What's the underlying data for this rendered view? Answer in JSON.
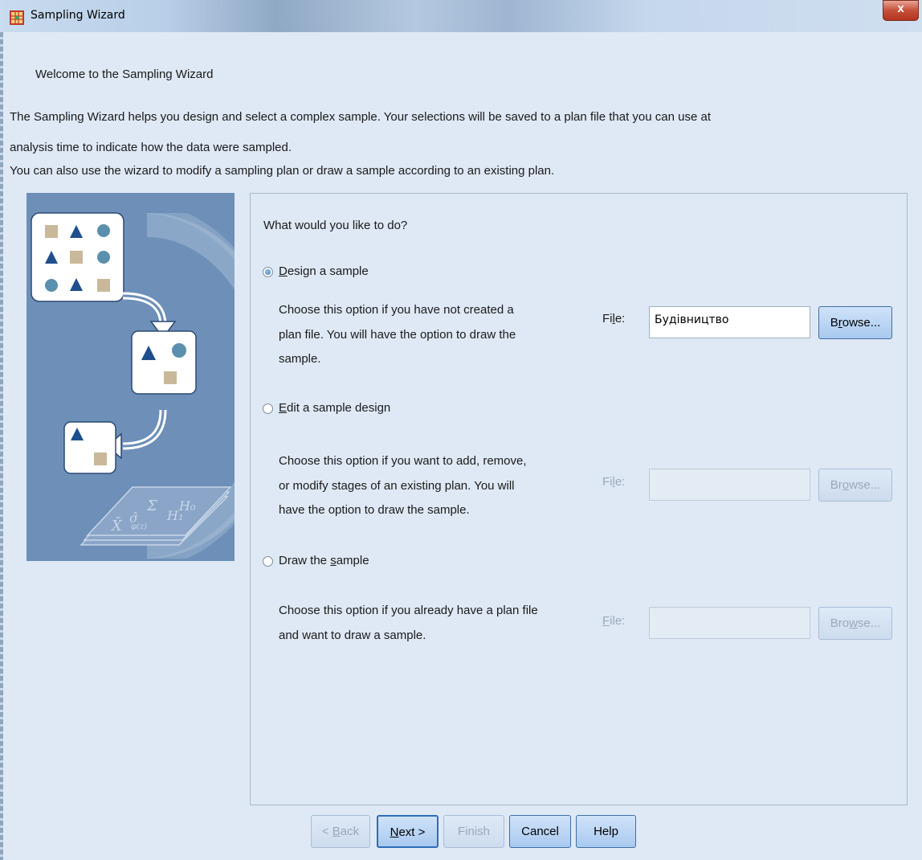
{
  "window": {
    "title": "Sampling Wizard",
    "close_label": "x"
  },
  "heading": "Welcome to the Sampling Wizard",
  "intro": {
    "line1": "The Sampling Wizard helps you design and select a complex sample. Your selections will be saved to a plan file that you can use at",
    "line2": "analysis time to indicate how the data were sampled.",
    "line3": "You can also use the wizard to modify a sampling plan or draw a sample according to an existing plan."
  },
  "question": "What would you like to do?",
  "options": [
    {
      "label_pre": "",
      "label_key": "D",
      "label_post": "esign a sample",
      "checked": true,
      "desc": [
        "Choose this option if you have not created a",
        "plan file. You will have the option to draw the",
        "sample."
      ],
      "file_label_pre": "Fi",
      "file_label_key": "l",
      "file_label_post": "e:",
      "file_value": "Будівництво",
      "browse_pre": "B",
      "browse_key": "r",
      "browse_post": "owse...",
      "enabled": true
    },
    {
      "label_pre": "",
      "label_key": "E",
      "label_post": "dit a sample design",
      "checked": false,
      "desc": [
        "Choose this option if you want to add, remove,",
        "or modify stages of an existing plan. You will",
        "have the option to draw the sample."
      ],
      "file_label_pre": "Fi",
      "file_label_key": "l",
      "file_label_post": "e:",
      "file_value": "",
      "browse_pre": "Br",
      "browse_key": "o",
      "browse_post": "wse...",
      "enabled": false
    },
    {
      "label_pre": "Draw the ",
      "label_key": "s",
      "label_post": "ample",
      "checked": false,
      "desc": [
        "Choose this option if you already have a plan file",
        "and want to draw a sample."
      ],
      "file_label_pre": "",
      "file_label_key": "F",
      "file_label_post": "ile:",
      "file_value": "",
      "browse_pre": "Bro",
      "browse_key": "w",
      "browse_post": "se...",
      "enabled": false
    }
  ],
  "footer": {
    "back_pre": "< ",
    "back_key": "B",
    "back_post": "ack",
    "next_key": "N",
    "next_post": "ext >",
    "finish": "Finish",
    "cancel": "Cancel",
    "help": "Help"
  }
}
